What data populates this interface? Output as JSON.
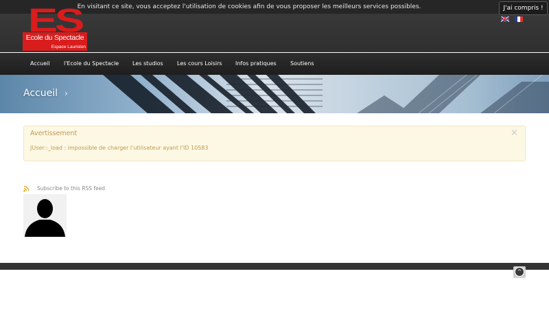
{
  "cookie": {
    "message": "En visitant ce site, vous acceptez l'utilisation de cookies afin de vous proposer les meilleurs services possibles.",
    "accept_label": "J'ai compris !"
  },
  "logo": {
    "letters": "ES",
    "line1": "Ecole du Spectacle",
    "line2": "Espace Lauriston"
  },
  "languages": [
    {
      "code": "en",
      "icon": "flag-uk-icon"
    },
    {
      "code": "fr",
      "icon": "flag-fr-icon"
    }
  ],
  "nav": {
    "items": [
      {
        "label": "Accueil"
      },
      {
        "label": "l'Ecole du Spectacle"
      },
      {
        "label": "Les studios"
      },
      {
        "label": "Les cours Loisirs"
      },
      {
        "label": "Infos pratiques"
      },
      {
        "label": "Soutiens"
      }
    ]
  },
  "banner": {
    "title": "Accueil",
    "chevron": "›"
  },
  "alert": {
    "title": "Avertissement",
    "message": "JUser::_load : impossible de charger l'utilisateur ayant l'ID 10583",
    "close": "×"
  },
  "rss": {
    "label": "Subscribe to this RSS feed",
    "icon": "rss-icon"
  },
  "footer": {
    "top_icon": "back-to-top-icon",
    "top_glyph": "^"
  },
  "colors": {
    "brand_red": "#d91c1c",
    "header_bg": "#333333",
    "alert_bg": "#fcf8e3",
    "alert_text": "#c09853"
  }
}
